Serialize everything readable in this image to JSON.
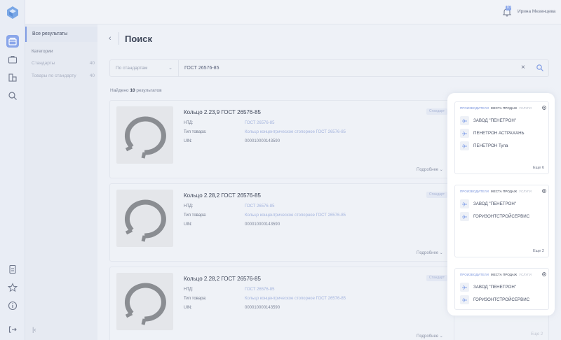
{
  "header": {
    "notification_count": "10",
    "user_name": "Ирина Мезенцева"
  },
  "sidebar": {
    "all_results": "Все результаты",
    "categories_title": "Категории",
    "categories": [
      {
        "label": "Стандарты",
        "count": "40"
      },
      {
        "label": "Товары по стандарту",
        "count": "40"
      }
    ]
  },
  "page": {
    "title": "Поиск",
    "search_mode": "По стандартам",
    "search_value": "ГОСТ 26576-85",
    "found_prefix": "Найдено",
    "found_count": "10",
    "found_suffix": "результатов"
  },
  "labels": {
    "ntd": "НТД:",
    "type": "Тип товара:",
    "uin": "UIN:",
    "more": "Подробнее",
    "tag": "Стандарт",
    "tab_manufacturers": "ПРОИЗВОДИТЕЛИ",
    "tab_sales": "МЕСТА ПРОДАЖ",
    "tab_services": "УСЛУГИ"
  },
  "results": [
    {
      "name": "Кольцо 2.23,9 ГОСТ 26576-85",
      "ntd": "ГОСТ 26576-85",
      "type": "Кольцо концентрическое стопорное ГОСТ 26576-85",
      "uin": "000010000143590",
      "vendors": [
        "ЗАВОД \"ПЕНЕТРОН\"",
        "ПЕНЕТРОН АСТРАХАНЬ",
        "ПЕНЕТРОН Тула"
      ],
      "more_vendors": "Еще 6"
    },
    {
      "name": "Кольцо 2.28,2 ГОСТ 26576-85",
      "ntd": "ГОСТ 26576-85",
      "type": "Кольцо концентрическое стопорное ГОСТ 26576-85",
      "uin": "000010000143590",
      "vendors": [
        "ЗАВОД \"ПЕНЕТРОН\"",
        "ГОРИЗОНТСТРОЙСЕРВИС"
      ],
      "more_vendors": "Еще 2"
    },
    {
      "name": "Кольцо 2.28,2 ГОСТ 26576-85",
      "ntd": "ГОСТ 26576-85",
      "type": "Кольцо концентрическое стопорное ГОСТ 26576-85",
      "uin": "000010000143590",
      "vendors": [
        "ЗАВОД \"ПЕНЕТРОН\"",
        "ГОРИЗОНТСТРОЙСЕРВИС"
      ],
      "more_vendors": "Еще 2"
    }
  ],
  "colors": {
    "accent": "#7f9be3",
    "link": "#a4b4de",
    "background": "#eef1f7"
  }
}
